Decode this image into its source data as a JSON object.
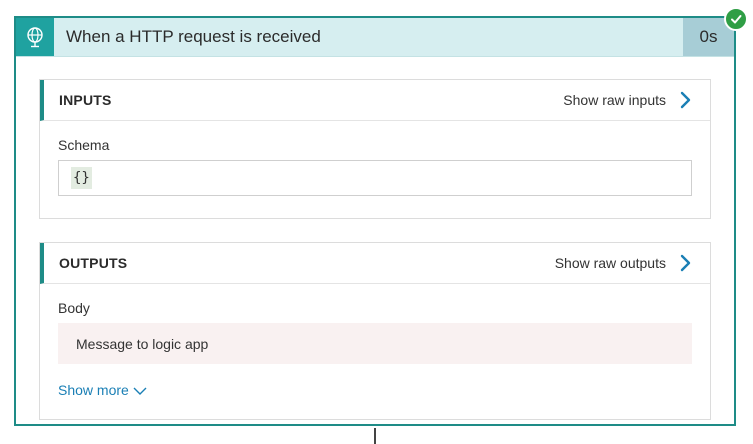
{
  "trigger": {
    "title": "When a HTTP request is received",
    "duration": "0s",
    "status": "succeeded",
    "icon": "globe-request-icon",
    "accent_color": "#1e8c87",
    "icon_bg_color": "#1fa2a0",
    "header_bg_color": "#d6eef0"
  },
  "inputs": {
    "heading": "INPUTS",
    "raw_link": "Show raw inputs",
    "schema_label": "Schema",
    "schema_value": "{}"
  },
  "outputs": {
    "heading": "OUTPUTS",
    "raw_link": "Show raw outputs",
    "body_label": "Body",
    "body_value": "Message to logic app",
    "show_more": "Show more"
  }
}
